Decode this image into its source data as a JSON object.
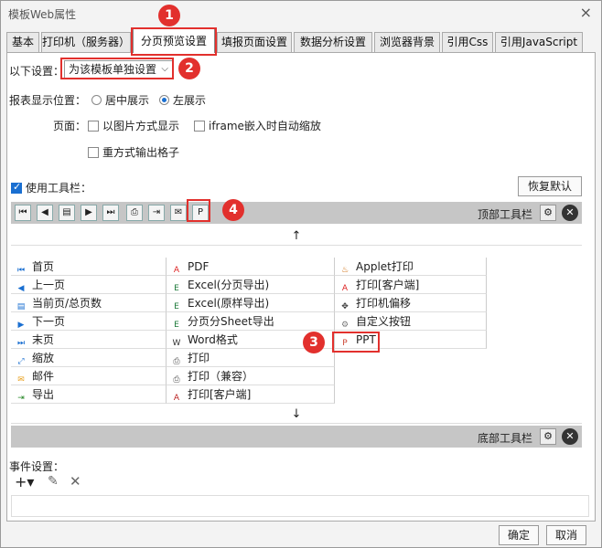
{
  "window": {
    "title": "模板Web属性",
    "close_glyph": "×"
  },
  "tabs": [
    {
      "label": "基本"
    },
    {
      "label": "打印机（服务器）"
    },
    {
      "label": "分页预览设置"
    },
    {
      "label": "填报页面设置"
    },
    {
      "label": "数据分析设置"
    },
    {
      "label": "浏览器背景"
    },
    {
      "label": "引用Css"
    },
    {
      "label": "引用JavaScript"
    }
  ],
  "settings": {
    "label": "以下设置：",
    "selected": "为该模板单独设置",
    "position_label": "报表显示位置：",
    "position_options": [
      "居中展示",
      "左展示"
    ],
    "page_label": "页面：",
    "page_options": [
      "以图片方式显示",
      "iframe嵌入时自动缩放",
      "重方式输出格子"
    ]
  },
  "toolbar": {
    "use_label": "使用工具栏：",
    "reset_label": "恢复默认",
    "top_label": "顶部工具栏",
    "bottom_label": "底部工具栏",
    "up_arrow": "↑",
    "down_arrow": "↓"
  },
  "grid": {
    "col1": [
      "首页",
      "上一页",
      "当前页/总页数",
      "下一页",
      "末页",
      "缩放",
      "邮件",
      "导出"
    ],
    "col2": [
      "PDF",
      "Excel(分页导出)",
      "Excel(原样导出)",
      "分页分Sheet导出",
      "Word格式",
      "打印",
      "打印（兼容）",
      "打印[客户端]"
    ],
    "col3": [
      "Applet打印",
      "打印[客户端]",
      "打印机偏移",
      "自定义按钮",
      "PPT"
    ]
  },
  "events": {
    "label": "事件设置："
  },
  "footer": {
    "ok": "确定",
    "cancel": "取消"
  },
  "badges": [
    "1",
    "2",
    "3",
    "4"
  ],
  "colors": {
    "accent": "#1a6fd1",
    "highlight": "#e2302d"
  }
}
